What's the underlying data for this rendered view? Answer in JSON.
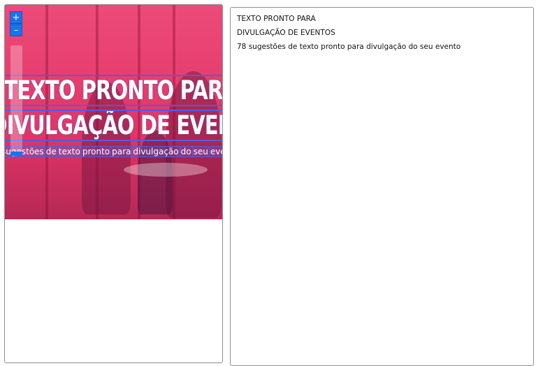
{
  "image": {
    "headline_line1": "TEXTO PRONTO PARA",
    "headline_line2": "DIVULGAÇÃO DE EVENTOS",
    "subline_words": [
      "sugestões",
      "de",
      "texto",
      "pronto",
      "para",
      "divulgação",
      "do",
      "seu",
      "evento"
    ],
    "accent_color": "#e83a6a",
    "outline_color": "#4f5fdc"
  },
  "zoom": {
    "in_label": "+",
    "out_label": "–"
  },
  "details": {
    "line1": "TEXTO PRONTO PARA",
    "line2": "DIVULGAÇÃO DE EVENTOS",
    "line3": "78 sugestões de texto pronto para divulgação do seu evento"
  }
}
